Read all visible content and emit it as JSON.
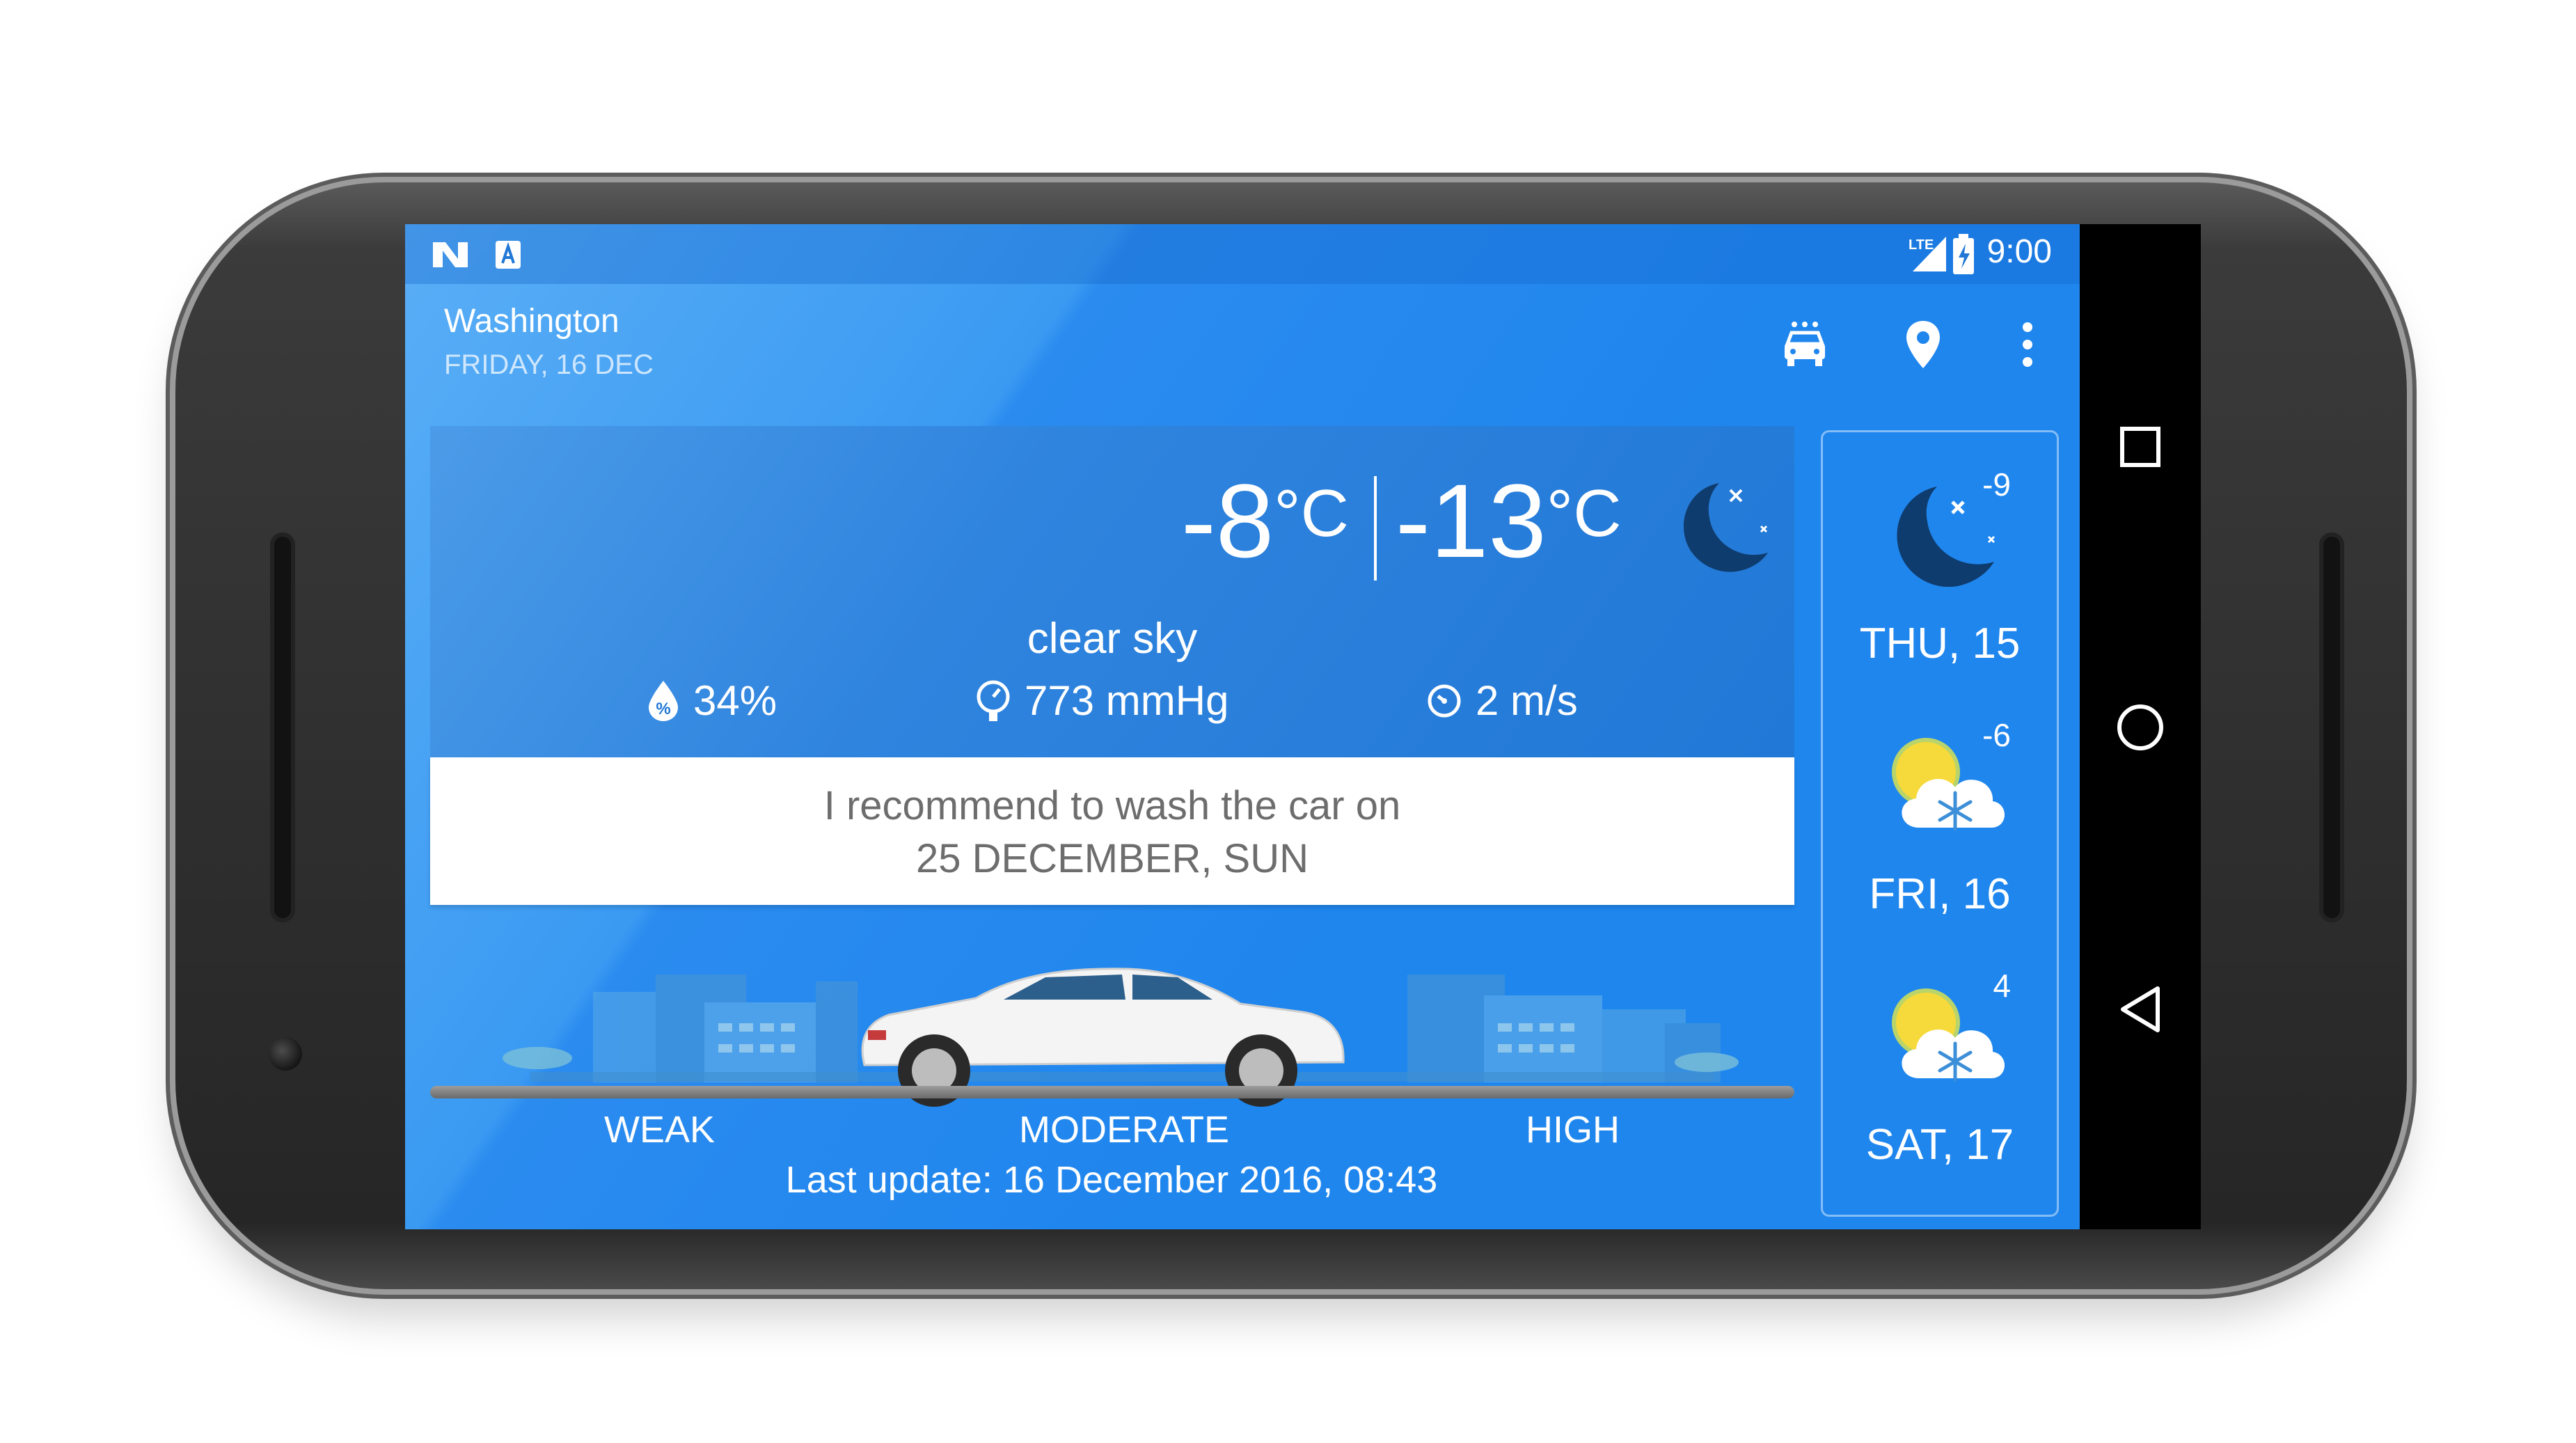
{
  "status_bar": {
    "time": "9:00",
    "left_icons": [
      "notification-n-icon",
      "notification-a-icon"
    ],
    "right_icons": [
      "lte-signal-icon",
      "battery-charging-icon"
    ]
  },
  "app_bar": {
    "city": "Washington",
    "date": "FRIDAY, 16 DEC",
    "actions": [
      "car-wash-icon",
      "location-pin-icon",
      "more-vert-icon"
    ]
  },
  "current": {
    "temp_now": "-8",
    "temp_low": "-13",
    "unit": "°C",
    "condition": "clear sky",
    "condition_icon": "moon-night-icon",
    "humidity": "34%",
    "pressure": "773 mmHg",
    "wind": "2 m/s"
  },
  "recommendation": {
    "line1": "I recommend to wash the car on",
    "line2": "25 DECEMBER, SUN"
  },
  "scale": {
    "weak": "WEAK",
    "moderate": "MODERATE",
    "high": "HIGH"
  },
  "last_update": "Last update: 16 December 2016, 08:43",
  "forecast": [
    {
      "day": "THU, 15",
      "temp": "-9",
      "icon": "moon-night-icon"
    },
    {
      "day": "FRI, 16",
      "temp": "-6",
      "icon": "sun-snow-cloud-icon"
    },
    {
      "day": "SAT, 17",
      "temp": "4",
      "icon": "sun-snow-cloud-icon"
    }
  ],
  "nav_bar": [
    "recents-square-icon",
    "home-circle-icon",
    "back-triangle-icon"
  ],
  "colors": {
    "primary": "#1f86ee",
    "card_dark": "#2178d6",
    "moon": "#0f3c6e",
    "sun": "#f6d93a"
  }
}
